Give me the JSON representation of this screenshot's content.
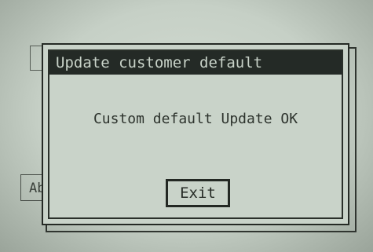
{
  "background": {
    "button_ab_label": "Ab"
  },
  "dialog": {
    "title": "Update customer default",
    "message": "Custom default Update OK",
    "exit_label": "Exit"
  },
  "colors": {
    "screen": "#c9d3c9",
    "title_bar": "#242a26",
    "text": "#2a2f2a"
  }
}
